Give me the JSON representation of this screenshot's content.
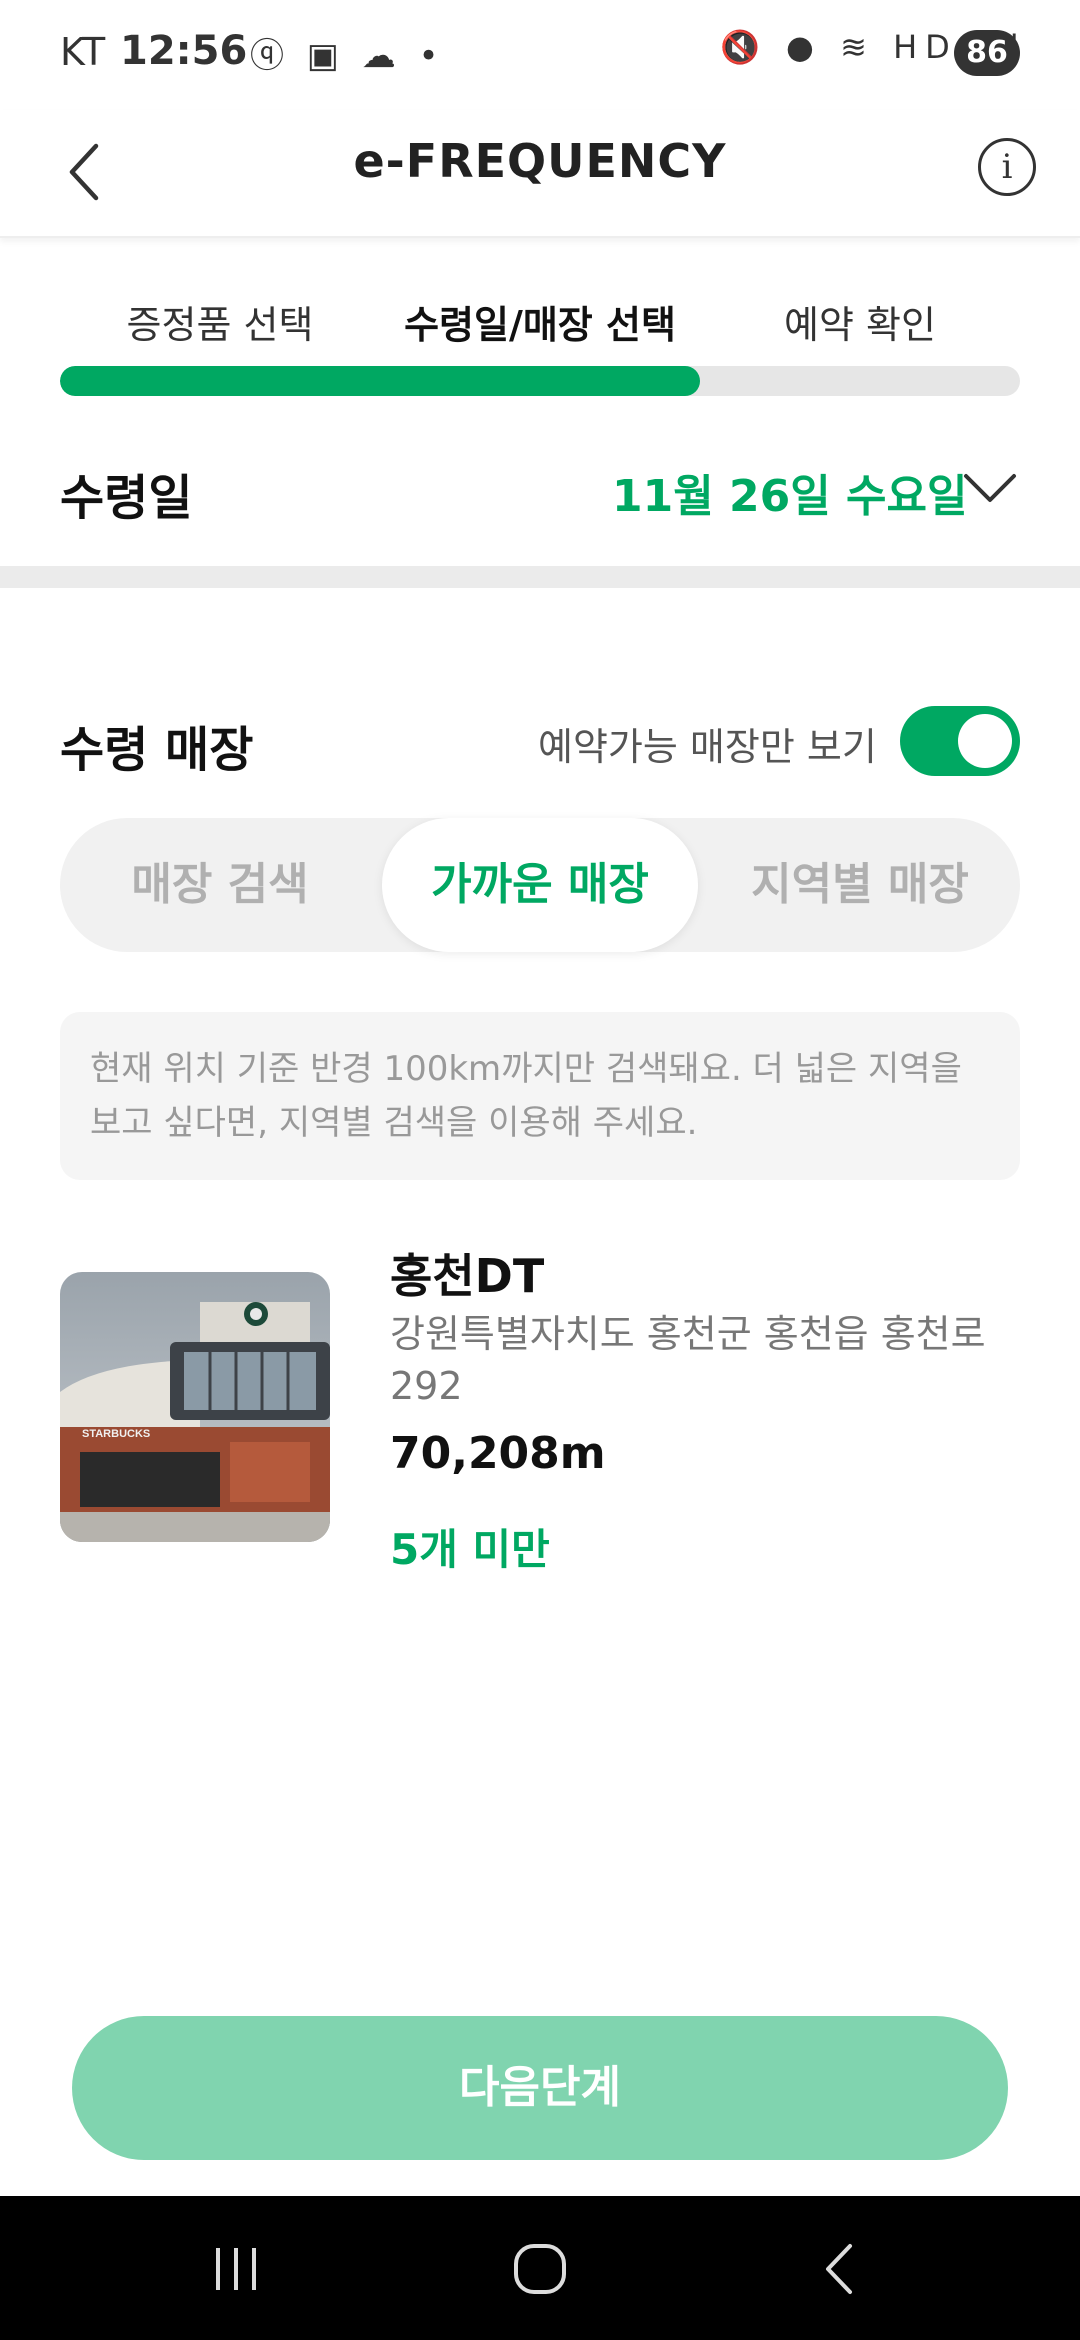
{
  "status_bar": {
    "carrier": "KT",
    "time": "12:56",
    "left_icons": "ⓠ ▣ ☁ •",
    "right_icons": "🔇 ● ≋ HD ıll",
    "battery": "86"
  },
  "header": {
    "title": "e-FREQUENCY",
    "back_icon": "chevron-left-icon",
    "info_icon": "info-icon",
    "info_glyph": "i"
  },
  "steps": {
    "items": [
      {
        "label": "증정품 선택",
        "active": false
      },
      {
        "label": "수령일/매장 선택",
        "active": true
      },
      {
        "label": "예약 확인",
        "active": false
      }
    ],
    "progress": 0.667
  },
  "pickup_date": {
    "label": "수령일",
    "value": "11월 26일 수요일"
  },
  "store_section": {
    "title": "수령 매장",
    "toggle_label": "예약가능 매장만 보기",
    "toggle_on": true,
    "tabs": [
      {
        "label": "매장 검색",
        "active": false
      },
      {
        "label": "가까운 매장",
        "active": true
      },
      {
        "label": "지역별 매장",
        "active": false
      }
    ],
    "notice": "현재 위치 기준 반경 100km까지만 검색돼요. 더 넓은 지역을 보고 싶다면, 지역별 검색을 이용해 주세요."
  },
  "stores": [
    {
      "name": "홍천DT",
      "address": "강원특별자치도 홍천군 홍천읍 홍천로 292",
      "distance": "70,208m",
      "stock": "5개 미만",
      "sign": "STARBUCKS"
    }
  ],
  "next_button": {
    "label": "다음단계"
  },
  "colors": {
    "accent": "#00a862",
    "button_disabled": "#80d4af",
    "muted": "#999999"
  }
}
